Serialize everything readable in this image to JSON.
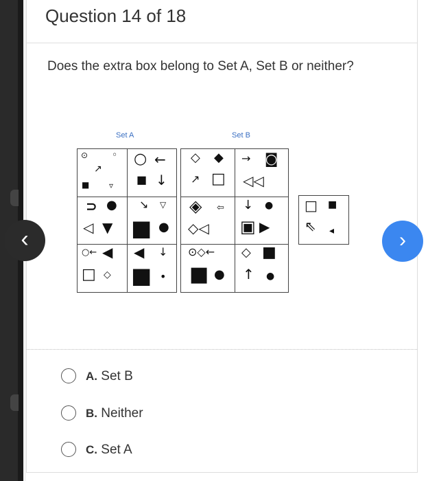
{
  "header": {
    "title": "Question 14 of 18"
  },
  "question": {
    "text": "Does the extra box belong to Set A, Set B or neither?"
  },
  "figure": {
    "set_a_label": "Set A",
    "set_b_label": "Set B",
    "set_a_cells": [
      [
        "⊙",
        "◦",
        "↗",
        "■",
        "▿"
      ],
      [
        "○",
        "←",
        "■",
        "↓"
      ],
      [
        "⊃",
        "●",
        "◁",
        "▼"
      ],
      [
        "↘",
        "▽",
        "■",
        "●"
      ],
      [
        "○←",
        "◀",
        "□",
        "◇"
      ],
      [
        "◀",
        "↓",
        "■",
        "•"
      ]
    ],
    "set_b_cells": [
      [
        "◇",
        "◆",
        "↗",
        "□"
      ],
      [
        "→",
        "◙",
        "◁◁"
      ],
      [
        "◈",
        "⇦",
        "◇◁"
      ],
      [
        "↓",
        "●",
        "▣",
        "▶"
      ],
      [
        "⊙◇←",
        "■",
        "●"
      ],
      [
        "◇",
        "■",
        "↑",
        "●"
      ]
    ],
    "extra_box": [
      "□",
      "■",
      "⇖",
      "◂"
    ]
  },
  "options": [
    {
      "letter": "A.",
      "label": "Set B"
    },
    {
      "letter": "B.",
      "label": "Neither"
    },
    {
      "letter": "C.",
      "label": "Set A"
    }
  ],
  "nav": {
    "prev_icon": "‹",
    "next_icon": "›"
  }
}
